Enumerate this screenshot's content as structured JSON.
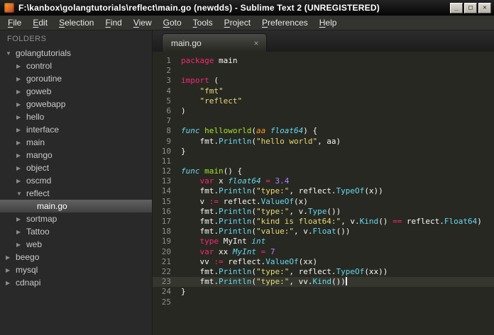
{
  "window": {
    "title": "F:\\kanbox\\golangtutorials\\reflect\\main.go (newdds) - Sublime Text 2 (UNREGISTERED)",
    "controls": {
      "minimize": "_",
      "maximize": "□",
      "close": "✕"
    }
  },
  "menu": {
    "items": [
      "File",
      "Edit",
      "Selection",
      "Find",
      "View",
      "Goto",
      "Tools",
      "Project",
      "Preferences",
      "Help"
    ]
  },
  "sidebar": {
    "header": "FOLDERS",
    "icons": {
      "expanded": "▼",
      "collapsed": "▶"
    },
    "tree": [
      {
        "label": "golangtutorials",
        "level": 0,
        "kind": "folder",
        "expanded": true,
        "selected": false
      },
      {
        "label": "control",
        "level": 1,
        "kind": "folder",
        "expanded": false,
        "selected": false
      },
      {
        "label": "goroutine",
        "level": 1,
        "kind": "folder",
        "expanded": false,
        "selected": false
      },
      {
        "label": "goweb",
        "level": 1,
        "kind": "folder",
        "expanded": false,
        "selected": false
      },
      {
        "label": "gowebapp",
        "level": 1,
        "kind": "folder",
        "expanded": false,
        "selected": false
      },
      {
        "label": "hello",
        "level": 1,
        "kind": "folder",
        "expanded": false,
        "selected": false
      },
      {
        "label": "interface",
        "level": 1,
        "kind": "folder",
        "expanded": false,
        "selected": false
      },
      {
        "label": "main",
        "level": 1,
        "kind": "folder",
        "expanded": false,
        "selected": false
      },
      {
        "label": "mango",
        "level": 1,
        "kind": "folder",
        "expanded": false,
        "selected": false
      },
      {
        "label": "object",
        "level": 1,
        "kind": "folder",
        "expanded": false,
        "selected": false
      },
      {
        "label": "oscmd",
        "level": 1,
        "kind": "folder",
        "expanded": false,
        "selected": false
      },
      {
        "label": "reflect",
        "level": 1,
        "kind": "folder",
        "expanded": true,
        "selected": false
      },
      {
        "label": "main.go",
        "level": 2,
        "kind": "file",
        "expanded": false,
        "selected": true
      },
      {
        "label": "sortmap",
        "level": 1,
        "kind": "folder",
        "expanded": false,
        "selected": false
      },
      {
        "label": "Tattoo",
        "level": 1,
        "kind": "folder",
        "expanded": false,
        "selected": false
      },
      {
        "label": "web",
        "level": 1,
        "kind": "folder",
        "expanded": false,
        "selected": false
      },
      {
        "label": "beego",
        "level": 0,
        "kind": "folder",
        "expanded": false,
        "selected": false
      },
      {
        "label": "mysql",
        "level": 0,
        "kind": "folder",
        "expanded": false,
        "selected": false
      },
      {
        "label": "cdnapi",
        "level": 0,
        "kind": "folder",
        "expanded": false,
        "selected": false
      }
    ]
  },
  "tabs": [
    {
      "label": "main.go",
      "active": true,
      "close_glyph": "×"
    }
  ],
  "editor": {
    "language": "Go",
    "cursor_line": 23,
    "token_classes": {
      "k": "keyword",
      "s": "storage-type",
      "f": "function-name",
      "a": "parameter",
      "t": "string",
      "n": "number",
      "u": "support-function",
      "p": "plain"
    },
    "lines": [
      [
        [
          "package",
          "k"
        ],
        [
          " main",
          "p"
        ]
      ],
      [],
      [
        [
          "import",
          "k"
        ],
        [
          " (",
          "p"
        ]
      ],
      [
        [
          "    ",
          "p"
        ],
        [
          "\"fmt\"",
          "t"
        ]
      ],
      [
        [
          "    ",
          "p"
        ],
        [
          "\"reflect\"",
          "t"
        ]
      ],
      [
        [
          ")",
          "p"
        ]
      ],
      [],
      [
        [
          "func",
          "s"
        ],
        [
          " ",
          "p"
        ],
        [
          "helloworld",
          "f"
        ],
        [
          "(",
          "p"
        ],
        [
          "aa",
          "a"
        ],
        [
          " ",
          "p"
        ],
        [
          "float64",
          "s"
        ],
        [
          ") {",
          "p"
        ]
      ],
      [
        [
          "    fmt.",
          "p"
        ],
        [
          "Println",
          "u"
        ],
        [
          "(",
          "p"
        ],
        [
          "\"hello world\"",
          "t"
        ],
        [
          ", aa)",
          "p"
        ]
      ],
      [
        [
          "}",
          "p"
        ]
      ],
      [],
      [
        [
          "func",
          "s"
        ],
        [
          " ",
          "p"
        ],
        [
          "main",
          "f"
        ],
        [
          "() {",
          "p"
        ]
      ],
      [
        [
          "    ",
          "p"
        ],
        [
          "var",
          "k"
        ],
        [
          " x ",
          "p"
        ],
        [
          "float64",
          "s"
        ],
        [
          " ",
          "p"
        ],
        [
          "=",
          "k"
        ],
        [
          " ",
          "p"
        ],
        [
          "3.4",
          "n"
        ]
      ],
      [
        [
          "    fmt.",
          "p"
        ],
        [
          "Println",
          "u"
        ],
        [
          "(",
          "p"
        ],
        [
          "\"type:\"",
          "t"
        ],
        [
          ", reflect.",
          "p"
        ],
        [
          "TypeOf",
          "u"
        ],
        [
          "(x))",
          "p"
        ]
      ],
      [
        [
          "    v ",
          "p"
        ],
        [
          ":=",
          "k"
        ],
        [
          " reflect.",
          "p"
        ],
        [
          "ValueOf",
          "u"
        ],
        [
          "(x)",
          "p"
        ]
      ],
      [
        [
          "    fmt.",
          "p"
        ],
        [
          "Println",
          "u"
        ],
        [
          "(",
          "p"
        ],
        [
          "\"type:\"",
          "t"
        ],
        [
          ", v.",
          "p"
        ],
        [
          "Type",
          "u"
        ],
        [
          "())",
          "p"
        ]
      ],
      [
        [
          "    fmt.",
          "p"
        ],
        [
          "Println",
          "u"
        ],
        [
          "(",
          "p"
        ],
        [
          "\"kind is float64:\"",
          "t"
        ],
        [
          ", v.",
          "p"
        ],
        [
          "Kind",
          "u"
        ],
        [
          "() ",
          "p"
        ],
        [
          "==",
          "k"
        ],
        [
          " reflect.",
          "p"
        ],
        [
          "Float64",
          "u"
        ],
        [
          ")",
          "p"
        ]
      ],
      [
        [
          "    fmt.",
          "p"
        ],
        [
          "Println",
          "u"
        ],
        [
          "(",
          "p"
        ],
        [
          "\"value:\"",
          "t"
        ],
        [
          ", v.",
          "p"
        ],
        [
          "Float",
          "u"
        ],
        [
          "())",
          "p"
        ]
      ],
      [
        [
          "    ",
          "p"
        ],
        [
          "type",
          "k"
        ],
        [
          " MyInt ",
          "p"
        ],
        [
          "int",
          "s"
        ]
      ],
      [
        [
          "    ",
          "p"
        ],
        [
          "var",
          "k"
        ],
        [
          " xx ",
          "p"
        ],
        [
          "MyInt",
          "s"
        ],
        [
          " ",
          "p"
        ],
        [
          "=",
          "k"
        ],
        [
          " ",
          "p"
        ],
        [
          "7",
          "n"
        ]
      ],
      [
        [
          "    vv ",
          "p"
        ],
        [
          ":=",
          "k"
        ],
        [
          " reflect.",
          "p"
        ],
        [
          "ValueOf",
          "u"
        ],
        [
          "(xx)",
          "p"
        ]
      ],
      [
        [
          "    fmt.",
          "p"
        ],
        [
          "Println",
          "u"
        ],
        [
          "(",
          "p"
        ],
        [
          "\"type:\"",
          "t"
        ],
        [
          ", reflect.",
          "p"
        ],
        [
          "TypeOf",
          "u"
        ],
        [
          "(xx))",
          "p"
        ]
      ],
      [
        [
          "    fmt.",
          "p"
        ],
        [
          "Println",
          "u"
        ],
        [
          "(",
          "p"
        ],
        [
          "\"type:\"",
          "t"
        ],
        [
          ", vv.",
          "p"
        ],
        [
          "Kind",
          "u"
        ],
        [
          "())",
          "p"
        ]
      ],
      [
        [
          "}",
          "p"
        ]
      ],
      []
    ]
  },
  "colors": {
    "editor_bg": "#272822",
    "sidebar_bg": "#292929",
    "keyword": "#f92672",
    "storage_type": "#66d9ef",
    "string": "#e6db74",
    "number": "#ae81ff",
    "function_name": "#a6e22e",
    "parameter": "#fd971f",
    "plain_text": "#f8f8f2",
    "line_number": "#8f908a",
    "current_line": "#35362e"
  }
}
